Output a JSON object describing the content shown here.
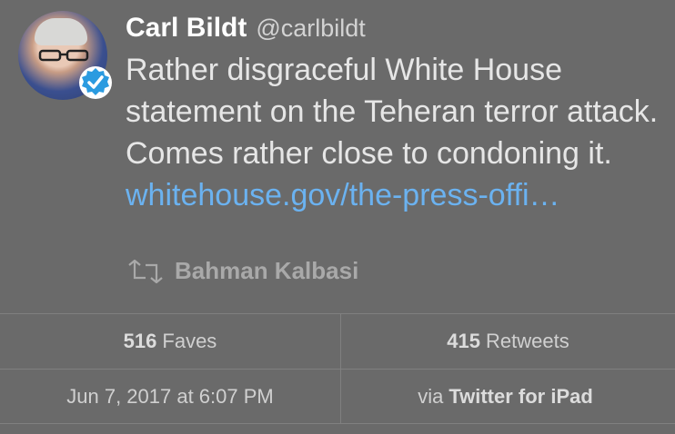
{
  "tweet": {
    "author_name": "Carl Bildt",
    "author_handle": "@carlbildt",
    "text_plain": "Rather disgraceful White House statement on the Teheran terror attack.  Comes rather close to condoning it.  ",
    "link_text": "whitehouse.gov/the-press-offi…",
    "retweeted_by": "Bahman Kalbasi",
    "icons": {
      "avatar": "avatar-photo",
      "verified": "verified-badge-icon",
      "retweet": "retweet-icon"
    },
    "colors": {
      "link": "#6bb2f0",
      "verified": "#2b9be0",
      "background": "#6a6a6a"
    }
  },
  "stats": {
    "faves_count": "516",
    "faves_label": "Faves",
    "retweets_count": "415",
    "retweets_label": "Retweets"
  },
  "meta": {
    "timestamp": "Jun 7, 2017 at 6:07 PM",
    "via_prefix": "via",
    "client": "Twitter for iPad"
  }
}
